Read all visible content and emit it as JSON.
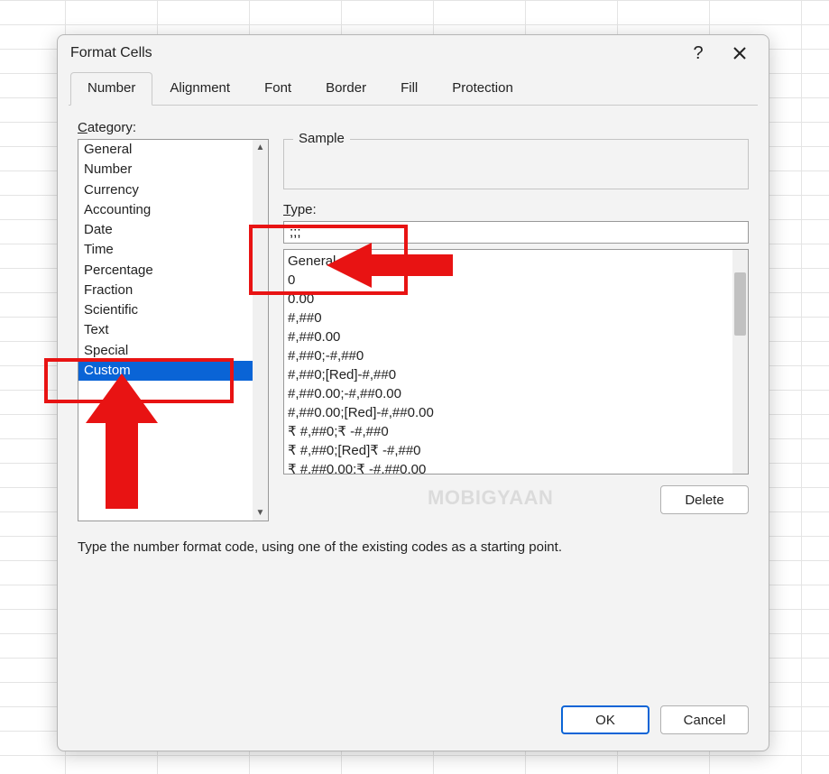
{
  "dialog": {
    "title": "Format Cells"
  },
  "tabs": {
    "number": "Number",
    "alignment": "Alignment",
    "font": "Font",
    "border": "Border",
    "fill": "Fill",
    "protection": "Protection"
  },
  "labels": {
    "category": "ategory:",
    "category_prefix": "C",
    "sample": "Sample",
    "type": "ype:",
    "type_prefix": "T",
    "delete": "Delete",
    "hint": "Type the number format code, using one of the existing codes as a starting point.",
    "ok": "OK",
    "cancel": "Cancel"
  },
  "categories": {
    "items": [
      "General",
      "Number",
      "Currency",
      "Accounting",
      "Date",
      "Time",
      "Percentage",
      "Fraction",
      "Scientific",
      "Text",
      "Special",
      "Custom"
    ],
    "selected_index": 11
  },
  "type_value": ";;;",
  "formats": [
    "General",
    "0",
    "0.00",
    "#,##0",
    "#,##0.00",
    "#,##0;-#,##0",
    "#,##0;[Red]-#,##0",
    "#,##0.00;-#,##0.00",
    "#,##0.00;[Red]-#,##0.00",
    "₹ #,##0;₹ -#,##0",
    "₹ #,##0;[Red]₹ -#,##0",
    "₹ #,##0.00;₹ -#,##0.00"
  ],
  "watermark": "MOBIGYAAN"
}
